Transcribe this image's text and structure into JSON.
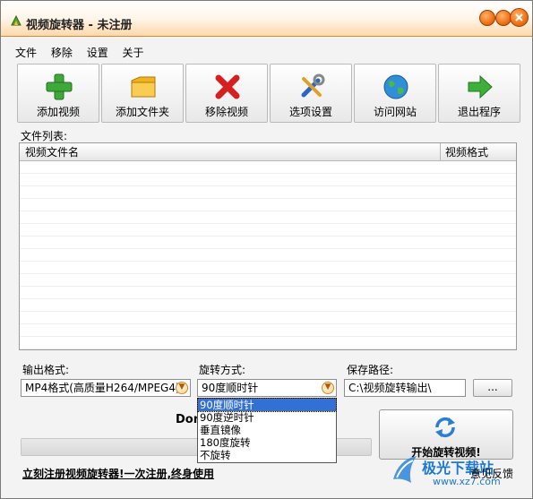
{
  "window": {
    "title": "视频旋转器 - 未注册"
  },
  "menu": [
    "文件",
    "移除",
    "设置",
    "关于"
  ],
  "toolbar": [
    {
      "label": "添加视频",
      "icon": "plus-icon"
    },
    {
      "label": "添加文件夹",
      "icon": "folder-icon"
    },
    {
      "label": "移除视频",
      "icon": "red-x-icon"
    },
    {
      "label": "选项设置",
      "icon": "tools-icon"
    },
    {
      "label": "访问网站",
      "icon": "globe-icon"
    },
    {
      "label": "退出程序",
      "icon": "exit-arrow-icon"
    }
  ],
  "file_list": {
    "label": "文件列表:",
    "columns": [
      "视频文件名",
      "视频格式"
    ]
  },
  "output": {
    "format_label": "输出格式:",
    "format_value": "MP4格式(高质量H264/MPEG4)",
    "rotate_label": "旋转方式:",
    "rotate_value": "90度顺时针",
    "rotate_options": [
      "90度顺时针",
      "90度逆时针",
      "垂直镜像",
      "180度旋转",
      "不旋转"
    ],
    "path_label": "保存路径:",
    "path_value": "C:\\视频旋转输出\\",
    "browse_label": "..."
  },
  "status": {
    "text": "Don",
    "progress": 0
  },
  "start_button": {
    "label": "开始旋转视频!"
  },
  "footer": {
    "register_text": "立刻注册视频旋转器!一次注册,终身使用",
    "feedback_text": "意见反馈"
  },
  "watermark": {
    "text": "极光下载站",
    "sub": "www.xz7.com"
  },
  "colors": {
    "title_gradient": "#ffd8a8",
    "accent_orange": "#f07818",
    "selection": "#3370d4"
  }
}
